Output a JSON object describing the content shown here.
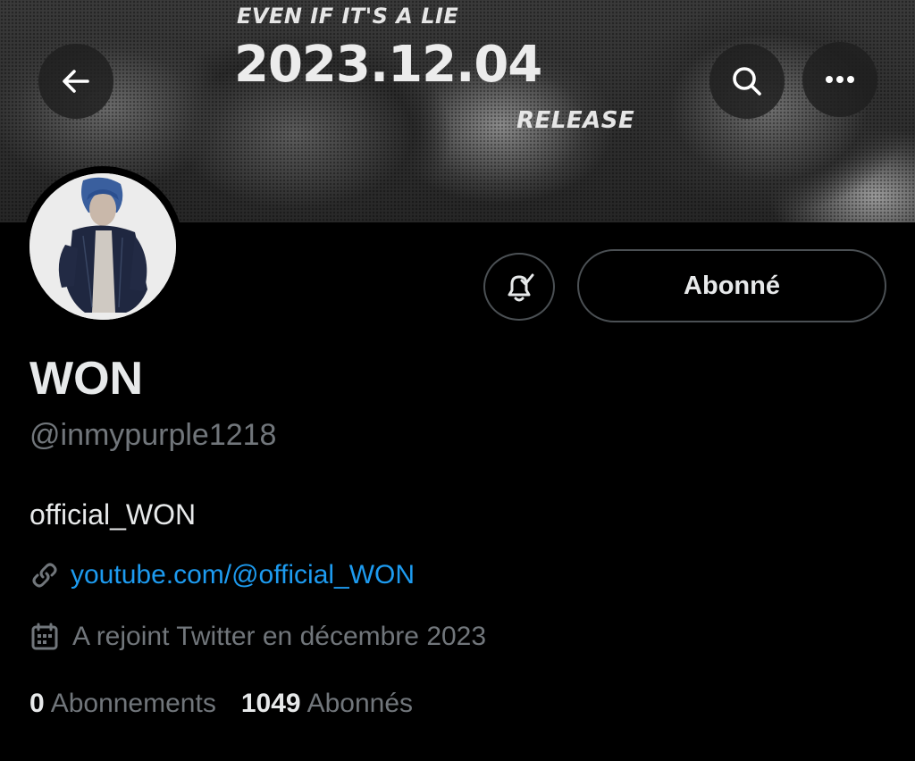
{
  "banner": {
    "line1": "EVEN IF IT'S A LIE",
    "date": "2023.12.04",
    "release": "RELEASE"
  },
  "icons": {
    "back": "arrow-left-icon",
    "search": "search-icon",
    "more": "more-horizontal-icon",
    "notifications": "bell-check-icon",
    "link": "link-icon",
    "calendar": "calendar-icon"
  },
  "profile": {
    "follow_button": "Abonné",
    "name": "WON",
    "handle": "@inmypurple1218",
    "bio": "official_WON",
    "link": "youtube.com/@official_WON",
    "joined": "A rejoint Twitter en décembre 2023"
  },
  "stats": {
    "following_count": "0",
    "following_label": "Abonnements",
    "followers_count": "1049",
    "followers_label": "Abonnés"
  },
  "colors": {
    "background": "#000000",
    "text": "#e7e9ea",
    "secondary": "#71767b",
    "link": "#1d9bf0",
    "border": "#4b5054"
  }
}
